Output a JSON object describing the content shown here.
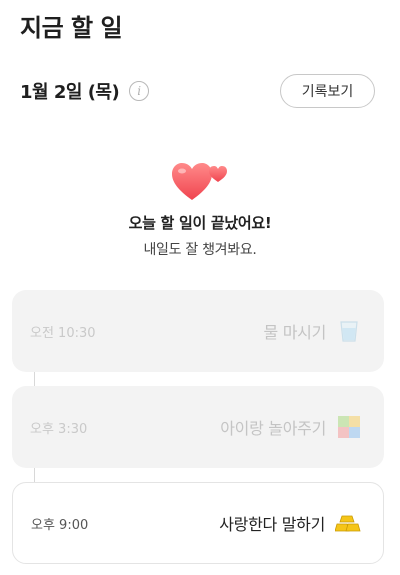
{
  "header": {
    "title": "지금 할 일"
  },
  "date_row": {
    "date": "1월 2일 (목)",
    "info_icon": "info-icon",
    "history_button": "기록보기"
  },
  "done_message": {
    "icon": "hearts-icon",
    "title": "오늘 할 일이 끝났어요!",
    "subtitle": "내일도 잘 챙겨봐요."
  },
  "tasks": [
    {
      "time": "오전 10:30",
      "name": "물 마시기",
      "icon": "water-glass-icon",
      "status": "done"
    },
    {
      "time": "오후 3:30",
      "name": "아이랑 놀아주기",
      "icon": "toy-blocks-icon",
      "status": "done"
    },
    {
      "time": "오후 9:00",
      "name": "사랑한다 말하기",
      "icon": "gold-bars-icon",
      "status": "active"
    }
  ]
}
